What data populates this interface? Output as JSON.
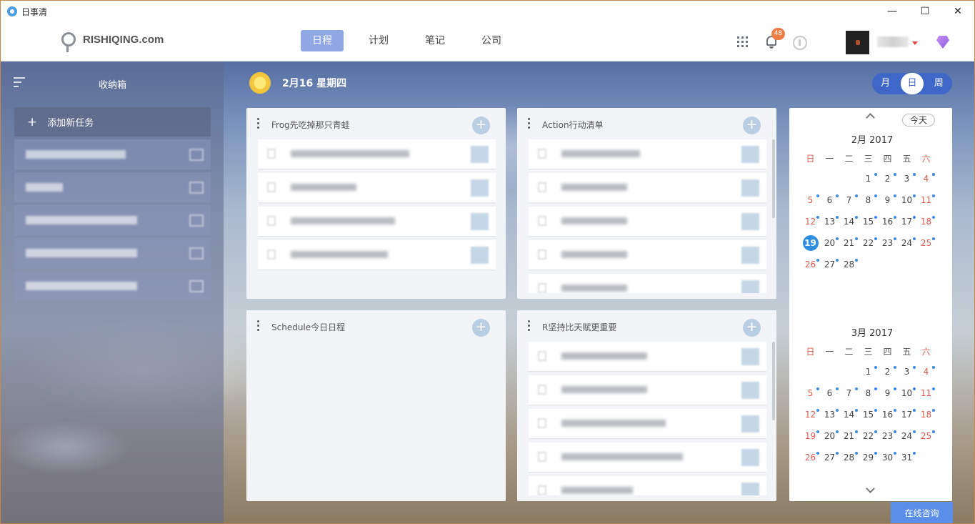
{
  "window": {
    "title": "日事清",
    "minimize": "—",
    "maximize": "☐",
    "close": "✕"
  },
  "header": {
    "logo_text": "RISHIQING.com",
    "nav": [
      {
        "label": "日程",
        "active": true
      },
      {
        "label": "计划",
        "active": false
      },
      {
        "label": "笔记",
        "active": false
      },
      {
        "label": "公司",
        "active": false
      }
    ],
    "notification_count": "48",
    "accent": "#8fa8e4"
  },
  "sidebar": {
    "title": "收纳箱",
    "add_task": "添加新任务",
    "items": [
      {
        "w": 140
      },
      {
        "w": 52
      },
      {
        "w": 156
      },
      {
        "w": 156
      },
      {
        "w": 156
      }
    ]
  },
  "date_header": {
    "date": "2月16 星期四"
  },
  "view_switch": [
    {
      "label": "月",
      "active": false
    },
    {
      "label": "日",
      "active": true
    },
    {
      "label": "周",
      "active": false
    }
  ],
  "panels": [
    {
      "title": "Frog先吃掉那只青蛙",
      "rows": [
        {
          "w": 166
        },
        {
          "w": 92
        },
        {
          "w": 146
        },
        {
          "w": 136
        }
      ]
    },
    {
      "title": "Action行动清单",
      "rows": [
        {
          "w": 110
        },
        {
          "w": 92
        },
        {
          "w": 92
        },
        {
          "w": 92
        },
        {
          "w": 92
        }
      ]
    },
    {
      "title": "Schedule今日日程",
      "rows": []
    },
    {
      "title": "R坚持比天赋更重要",
      "rows": [
        {
          "w": 120
        },
        {
          "w": 120
        },
        {
          "w": 146
        },
        {
          "w": 170
        },
        {
          "w": 100
        }
      ]
    }
  ],
  "calendar": {
    "today_btn": "今天",
    "weekdays": [
      "日",
      "一",
      "二",
      "三",
      "四",
      "五",
      "六"
    ],
    "months": [
      {
        "title": "2月 2017",
        "lead": 3,
        "days": 28,
        "current": 19,
        "dots": [
          1,
          2,
          3,
          4,
          5,
          6,
          7,
          8,
          9,
          10,
          11,
          12,
          13,
          14,
          15,
          16,
          17,
          18,
          20,
          21,
          22,
          23,
          24,
          25,
          26,
          27,
          28
        ]
      },
      {
        "title": "3月 2017",
        "lead": 3,
        "days": 31,
        "current": 0,
        "dots": [
          1,
          2,
          3,
          4,
          5,
          6,
          7,
          8,
          9,
          10,
          11,
          12,
          13,
          14,
          15,
          16,
          17,
          18,
          19,
          20,
          21,
          22,
          23,
          24,
          25,
          26,
          27,
          28,
          29,
          30,
          31
        ]
      }
    ]
  },
  "consult_button": "在线咨询"
}
